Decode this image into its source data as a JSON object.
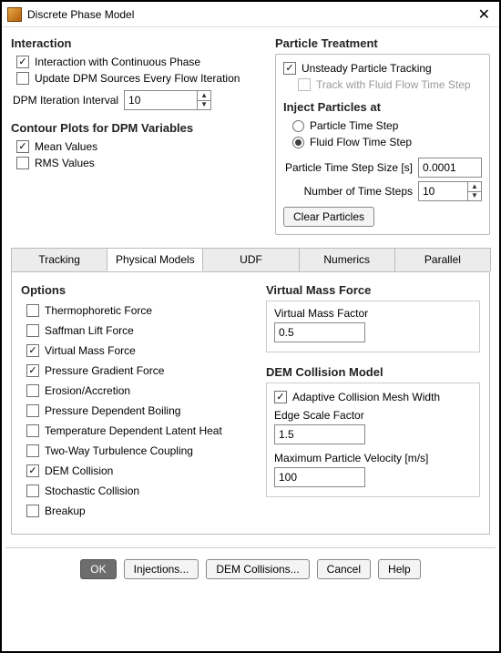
{
  "window": {
    "title": "Discrete Phase Model"
  },
  "interaction": {
    "heading": "Interaction",
    "with_continuous": "Interaction with Continuous Phase",
    "update_every_iter": "Update DPM Sources Every Flow Iteration",
    "iter_interval_label": "DPM Iteration Interval",
    "iter_interval_value": "10"
  },
  "contour": {
    "heading": "Contour Plots for DPM Variables",
    "mean": "Mean Values",
    "rms": "RMS Values"
  },
  "treatment": {
    "heading": "Particle Treatment",
    "unsteady": "Unsteady Particle Tracking",
    "track_fluid": "Track with Fluid Flow Time Step",
    "inject_heading": "Inject Particles at",
    "opt_particle_ts": "Particle Time Step",
    "opt_fluid_ts": "Fluid Flow Time Step",
    "ts_size_label": "Particle Time Step Size [s]",
    "ts_size_value": "0.0001",
    "num_steps_label": "Number of Time Steps",
    "num_steps_value": "10",
    "clear_btn": "Clear Particles"
  },
  "tabs": {
    "tracking": "Tracking",
    "physical": "Physical Models",
    "udf": "UDF",
    "numerics": "Numerics",
    "parallel": "Parallel"
  },
  "options": {
    "heading": "Options",
    "items": [
      {
        "label": "Thermophoretic Force",
        "checked": false
      },
      {
        "label": "Saffman Lift Force",
        "checked": false
      },
      {
        "label": "Virtual Mass Force",
        "checked": true
      },
      {
        "label": "Pressure Gradient Force",
        "checked": true
      },
      {
        "label": "Erosion/Accretion",
        "checked": false
      },
      {
        "label": "Pressure Dependent Boiling",
        "checked": false
      },
      {
        "label": "Temperature Dependent Latent Heat",
        "checked": false
      },
      {
        "label": "Two-Way Turbulence Coupling",
        "checked": false
      },
      {
        "label": "DEM Collision",
        "checked": true
      },
      {
        "label": "Stochastic Collision",
        "checked": false
      },
      {
        "label": "Breakup",
        "checked": false
      }
    ]
  },
  "vmf": {
    "heading": "Virtual Mass Force",
    "factor_label": "Virtual Mass Factor",
    "factor_value": "0.5"
  },
  "dem": {
    "heading": "DEM Collision Model",
    "adaptive": "Adaptive Collision Mesh Width",
    "edge_label": "Edge Scale Factor",
    "edge_value": "1.5",
    "maxvel_label": "Maximum Particle Velocity [m/s]",
    "maxvel_value": "100"
  },
  "footer": {
    "ok": "OK",
    "injections": "Injections...",
    "dem_collisions": "DEM Collisions...",
    "cancel": "Cancel",
    "help": "Help"
  }
}
